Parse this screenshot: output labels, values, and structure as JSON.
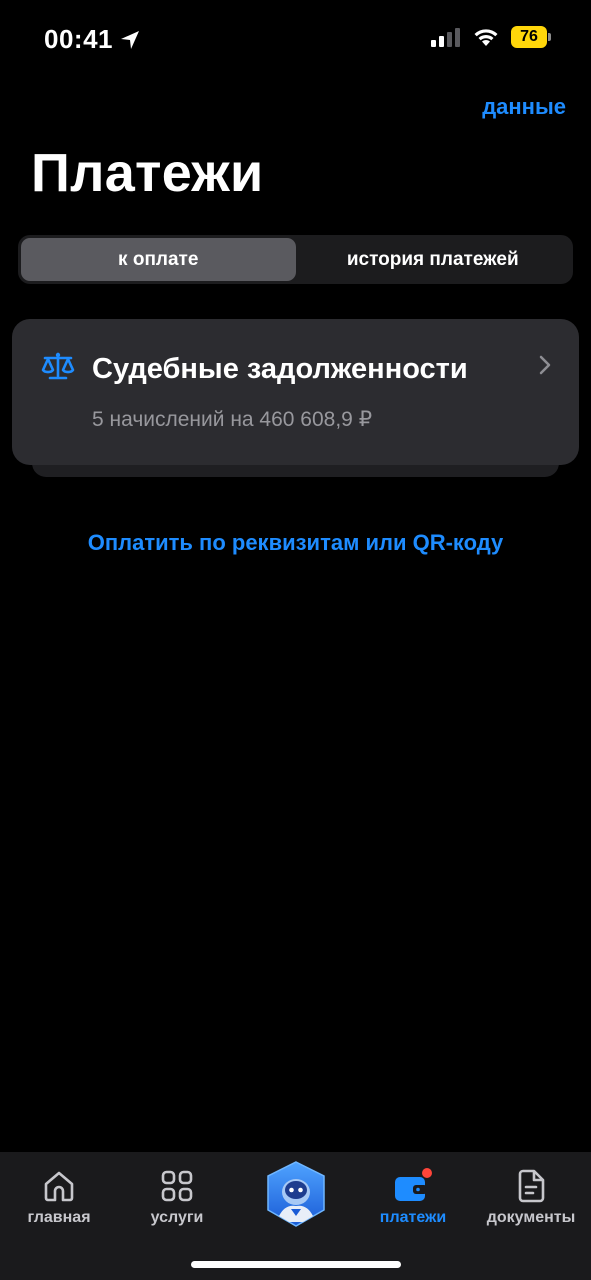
{
  "status_bar": {
    "time": "00:41",
    "battery": "76"
  },
  "header": {
    "top_link": "данные",
    "title": "Платежи"
  },
  "segments": [
    {
      "label": "к оплате",
      "active": true
    },
    {
      "label": "история платежей",
      "active": false
    }
  ],
  "card": {
    "title": "Судебные задолженности",
    "subtitle": "5 начислений на 460 608,9 ₽"
  },
  "pay_link": "Оплатить по реквизитам или QR-коду",
  "tabbar": {
    "items": [
      {
        "label": "главная",
        "icon": "home-icon"
      },
      {
        "label": "услуги",
        "icon": "grid-icon"
      },
      {
        "label": "",
        "icon": "assistant-robot-icon"
      },
      {
        "label": "платежи",
        "icon": "wallet-icon",
        "active": true
      },
      {
        "label": "документы",
        "icon": "document-icon"
      }
    ]
  },
  "colors": {
    "accent": "#1e8cff",
    "background": "#000000",
    "card": "#2c2c30",
    "battery": "#ffd60a",
    "notification_dot": "#ff453a"
  }
}
